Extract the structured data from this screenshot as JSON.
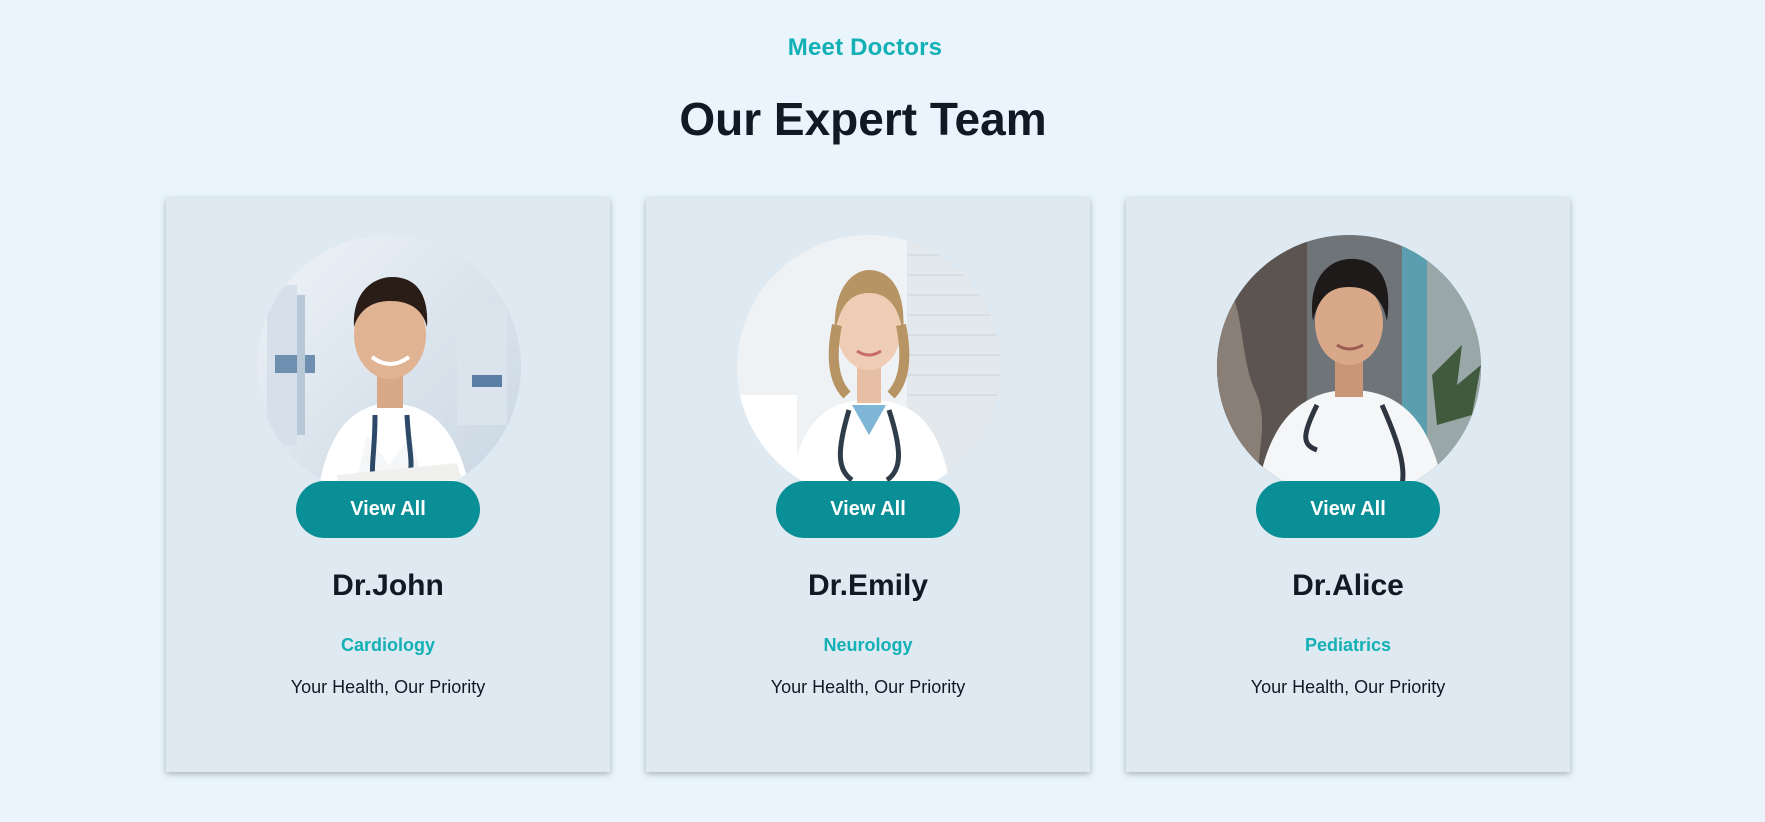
{
  "section": {
    "eyebrow": "Meet Doctors",
    "title": "Our Expert Team"
  },
  "doctors": [
    {
      "name": "Dr.John",
      "specialty": "Cardiology",
      "tagline": "Your Health, Our Priority",
      "button_label": "View All",
      "photo": "doctor-portrait-man-stethoscope"
    },
    {
      "name": "Dr.Emily",
      "specialty": "Neurology",
      "tagline": "Your Health, Our Priority",
      "button_label": "View All",
      "photo": "doctor-portrait-woman-stethoscope"
    },
    {
      "name": "Dr.Alice",
      "specialty": "Pediatrics",
      "tagline": "Your Health, Our Priority",
      "button_label": "View All",
      "photo": "doctor-portrait-young-man-stethoscope"
    }
  ],
  "colors": {
    "page_background": "#e9f4fc",
    "card_background": "#dfe9f1",
    "accent_teal": "#13b0b5",
    "button_teal": "#0b8f97",
    "heading_text": "#111a24"
  }
}
